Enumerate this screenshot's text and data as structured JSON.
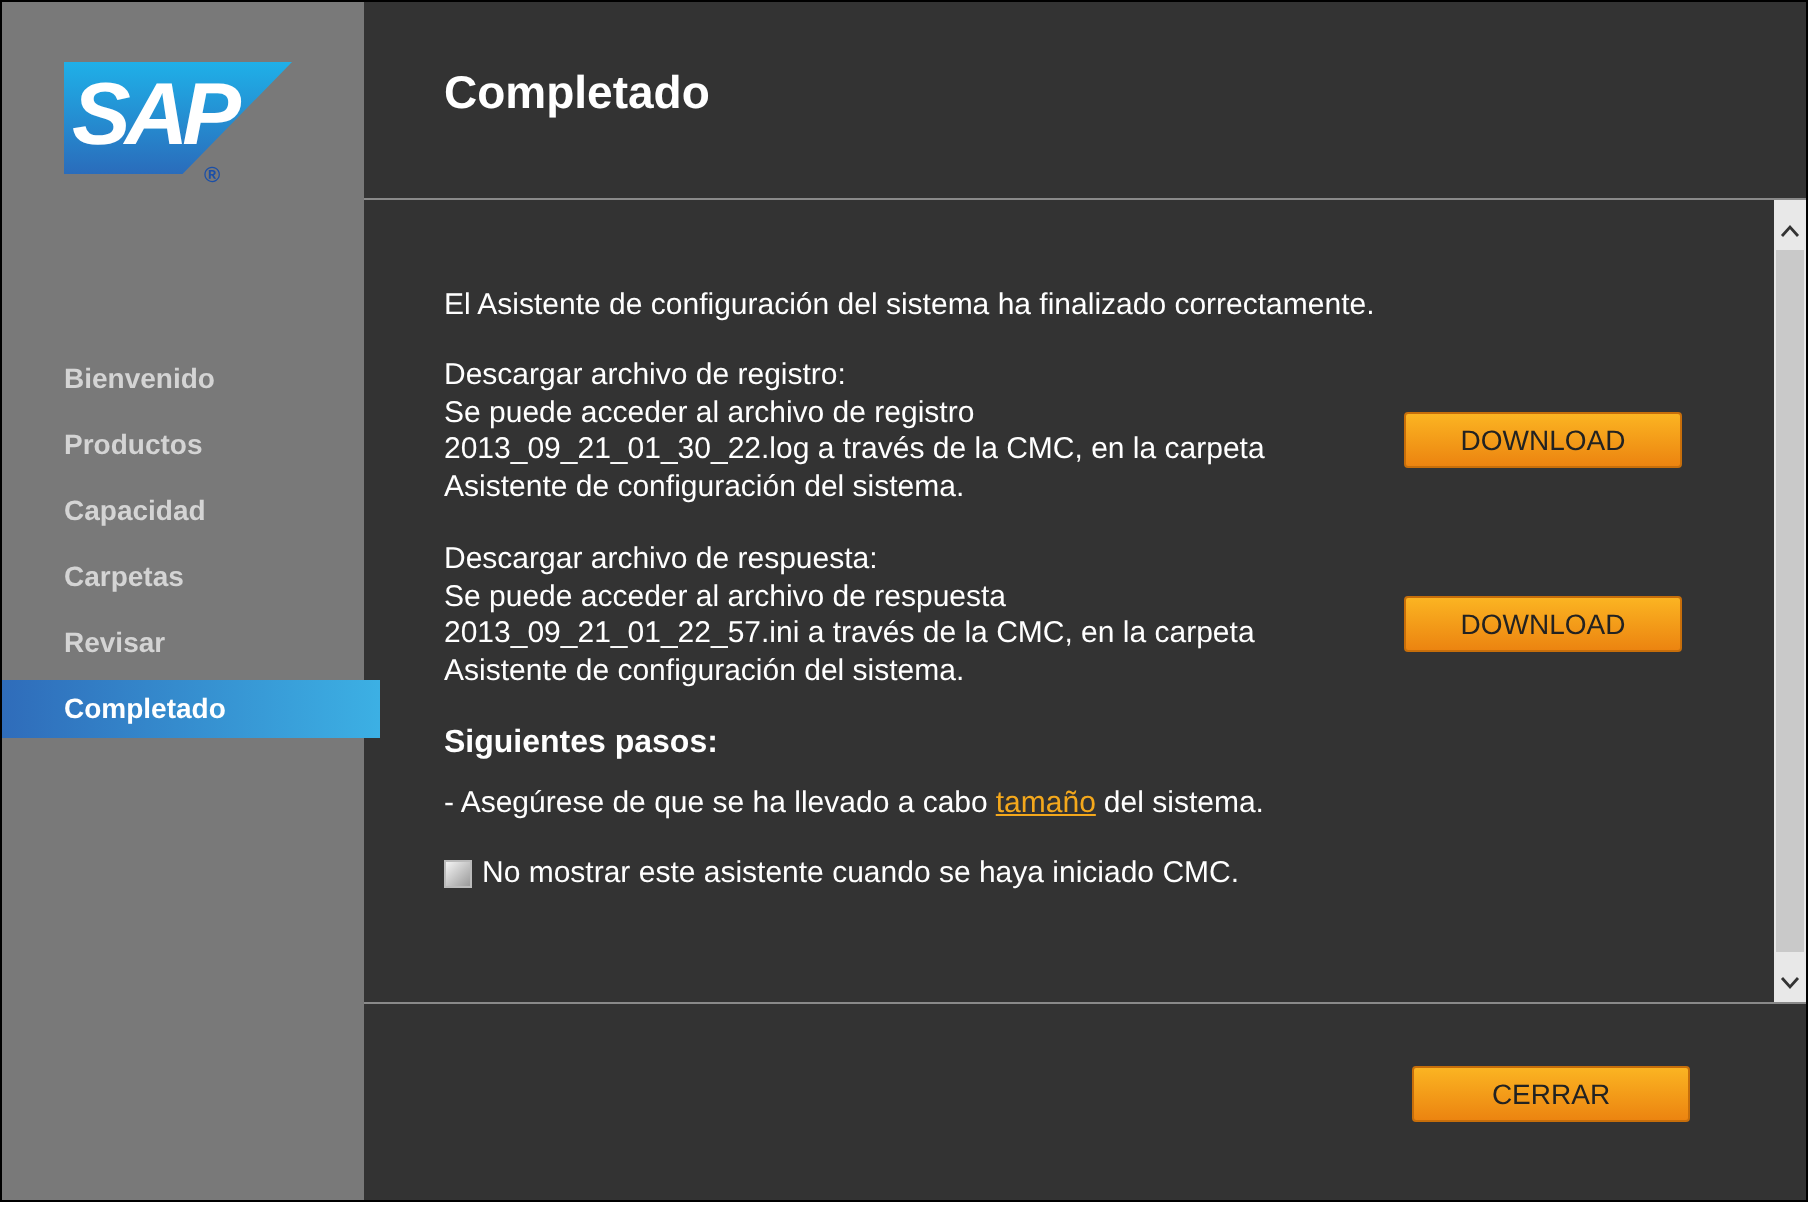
{
  "logo": {
    "text": "SAP",
    "mark": "®"
  },
  "sidebar": {
    "items": [
      {
        "label": "Bienvenido",
        "selected": false
      },
      {
        "label": "Productos",
        "selected": false
      },
      {
        "label": "Capacidad",
        "selected": false
      },
      {
        "label": "Carpetas",
        "selected": false
      },
      {
        "label": "Revisar",
        "selected": false
      },
      {
        "label": "Completado",
        "selected": true
      }
    ]
  },
  "title": "Completado",
  "message": "El Asistente de configuración del sistema ha finalizado correctamente.",
  "downloads": [
    {
      "heading": "Descargar archivo de registro:",
      "lines": [
        "Se puede acceder al archivo de registro",
        "2013_09_21_01_30_22.log a través de la CMC, en la carpeta",
        "Asistente de configuración del sistema."
      ],
      "button": "DOWNLOAD"
    },
    {
      "heading": "Descargar archivo de respuesta:",
      "lines": [
        "Se puede acceder al archivo de respuesta",
        "2013_09_21_01_22_57.ini a través de la CMC, en la carpeta",
        "Asistente de configuración del sistema."
      ],
      "button": "DOWNLOAD"
    }
  ],
  "next_steps": {
    "heading": "Siguientes pasos:",
    "before": "- Asegúrese de que se ha llevado a cabo",
    "link": "tamaño",
    "after": "del sistema."
  },
  "option": {
    "label": "No mostrar este asistente cuando se haya iniciado CMC.",
    "checked": false
  },
  "close_button": "CERRAR"
}
